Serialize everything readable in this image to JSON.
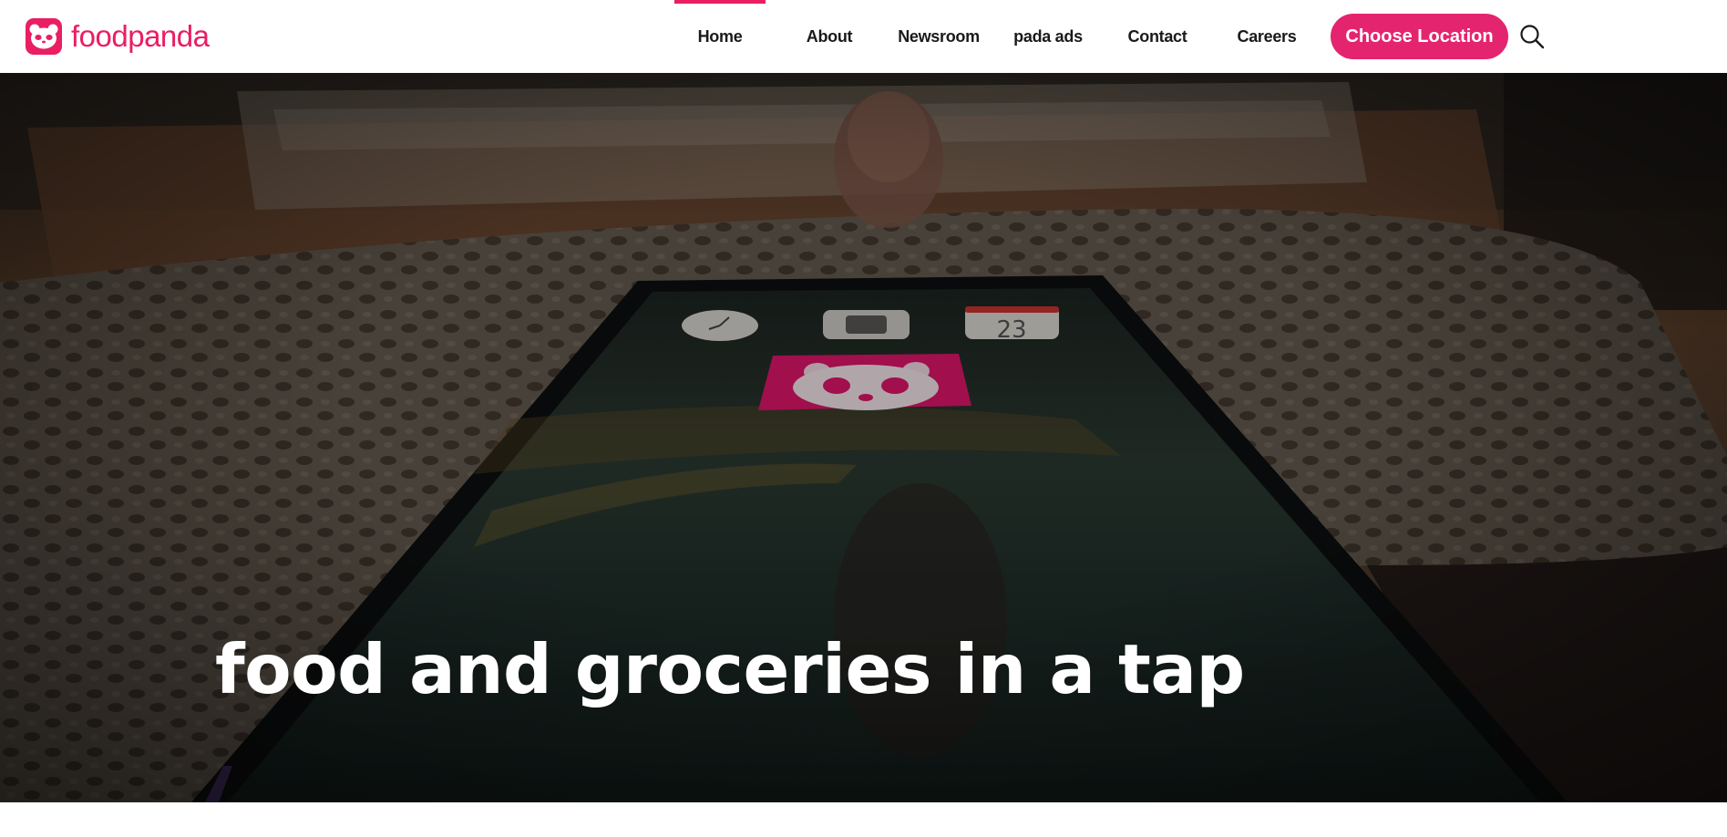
{
  "brand": {
    "name": "foodpanda",
    "logo_icon": "panda-icon",
    "color": "#e91e63"
  },
  "nav": {
    "items": [
      {
        "label": "Home",
        "active": true
      },
      {
        "label": "About",
        "active": false
      },
      {
        "label": "Newsroom",
        "active": false
      },
      {
        "label": "pada ads",
        "active": false
      },
      {
        "label": "Contact",
        "active": false
      },
      {
        "label": "Careers",
        "active": false
      }
    ],
    "cta_label": "Choose Location",
    "search_icon": "search-icon"
  },
  "hero": {
    "title": "food and groceries in a tap",
    "calendar_day": "23"
  }
}
